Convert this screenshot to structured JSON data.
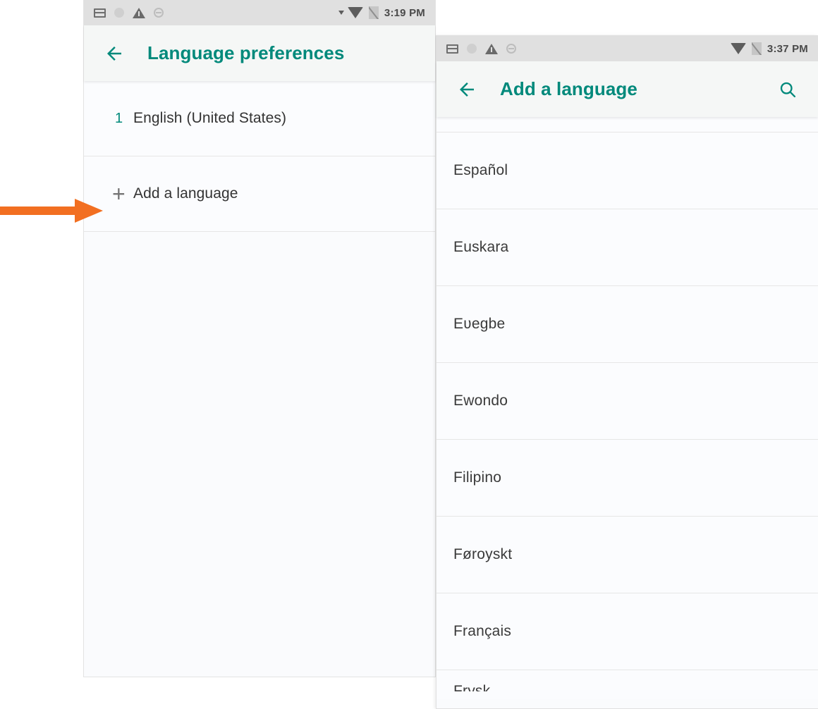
{
  "colors": {
    "accent_teal": "#00897b",
    "annotation_orange": "#f26f21",
    "statusbar_bg": "#e0e0e0",
    "toolbar_bg": "#f5f7f6",
    "list_bg": "#fbfcfe",
    "divider": "#e6e6e6",
    "primary_text": "#333333"
  },
  "left_panel": {
    "statusbar": {
      "time": "3:19 PM",
      "icons_left": [
        "card-icon",
        "circle-icon",
        "warning-icon",
        "sync-icon"
      ],
      "icons_right": [
        "signal-dot-icon",
        "wifi-icon",
        "sim-off-icon"
      ]
    },
    "toolbar": {
      "back_icon": "back-arrow-icon",
      "title": "Language preferences"
    },
    "rows": [
      {
        "index": "1",
        "label": "English (United States)",
        "type": "language"
      },
      {
        "index": "+",
        "label": "Add a language",
        "type": "action"
      }
    ]
  },
  "right_panel": {
    "statusbar": {
      "time": "3:37 PM",
      "icons_left": [
        "card-icon",
        "circle-icon",
        "warning-icon",
        "sync-icon"
      ],
      "icons_right": [
        "wifi-icon",
        "sim-off-icon"
      ]
    },
    "toolbar": {
      "back_icon": "back-arrow-icon",
      "title": "Add a language",
      "search_icon": "search-icon"
    },
    "languages": [
      {
        "label": "",
        "clipped": "top"
      },
      {
        "label": "Español",
        "clipped": "none"
      },
      {
        "label": "Euskara",
        "clipped": "none"
      },
      {
        "label": "Eʋegbe",
        "clipped": "none"
      },
      {
        "label": "Ewondo",
        "clipped": "none"
      },
      {
        "label": "Filipino",
        "clipped": "none"
      },
      {
        "label": "Føroyskt",
        "clipped": "none"
      },
      {
        "label": "Français",
        "clipped": "none"
      },
      {
        "label": "Frysk",
        "clipped": "bottom"
      }
    ]
  },
  "annotation": {
    "arrow_label": "pointer-to-add-a-language",
    "color": "#f26f21"
  }
}
